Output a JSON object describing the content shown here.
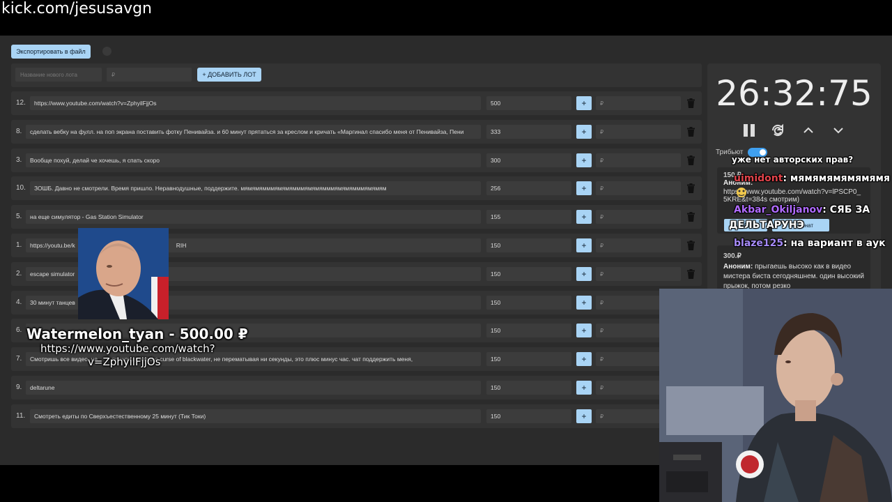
{
  "browser": {
    "url": "kick.com/jesusavgn"
  },
  "toolbar": {
    "export_label": "Экспортировать в файл"
  },
  "new_lot": {
    "name_placeholder": "Название нового лота",
    "amount_placeholder": "₽",
    "add_label": "+ ДОБАВИТЬ ЛОТ"
  },
  "lots": [
    {
      "num": "12.",
      "name": "https://www.youtube.com/watch?v=ZphyilFjjOs",
      "amount": "500"
    },
    {
      "num": "8.",
      "name": "сделать вебку на фулл. на поп экрана поставить фотку Пенивайза. и 60 минут прятаться за креслом и кричать «Маргинал спасибо меня от Пенивайза, Пени",
      "amount": "333"
    },
    {
      "num": "3.",
      "name": "Вообще похуй, делай че хочешь, я спать скоро",
      "amount": "300"
    },
    {
      "num": "10.",
      "name": "ЗОШБ. Давно не смотрели. Время пришло. Неравнодушные, поддержите. мямямямммямямямммямямямммямямямммямямям",
      "amount": "256"
    },
    {
      "num": "5.",
      "name": "на еще симулятор - Gas Station Simulator",
      "amount": "155"
    },
    {
      "num": "1.",
      "name": "https://youtu.be/k",
      "name_tail": "RIH",
      "amount": "150"
    },
    {
      "num": "2.",
      "name": "escape simulator",
      "amount": "150"
    },
    {
      "num": "4.",
      "name": "30 минут танцев",
      "amount": "150"
    },
    {
      "num": "6.",
      "name": "",
      "amount": "150"
    },
    {
      "num": "7.",
      "name": "Смотришь все видео, на            прохождение the curse of blackwater, не перематывая ни секунды, это плюс минус час. чат поддержить меня,",
      "amount": "150"
    },
    {
      "num": "9.",
      "name": "deltarune",
      "amount": "150"
    },
    {
      "num": "11.",
      "name": "Смотреть едиты по Сверхъестественному 25 минут (Тик Токи)",
      "amount": "150"
    }
  ],
  "lot_plus_label": "+",
  "lot_rub_placeholder": "₽",
  "timer": {
    "value": "26:32:75",
    "tribute_label": "Трибьют",
    "tribute_on": true
  },
  "donations": [
    {
      "amount": "150.₽",
      "author": "Аноним:",
      "text": "https://www.youtube.com/watch?v=lPSCP0_5KRE&t=384s смотрим)"
    },
    {
      "amount": "300.₽",
      "author": "Аноним:",
      "text": "прыгаешь высоко как в видео мистера биста сегодняшнем. один высокий прыжок, потом резко"
    }
  ],
  "donation_buttons": {
    "left": "С",
    "right": "ить донат"
  },
  "chat_overlay": [
    {
      "user": "uimidont",
      "message": ": мямямямямямямя"
    },
    {
      "user": "Akbar_Okiljanov",
      "message": ": СЯБ ЗА"
    },
    {
      "user": "",
      "message": "ДЕЛЬТАРУНЭ"
    },
    {
      "user": "blaze125",
      "message": ": на вариант в аук"
    }
  ],
  "chat_top_cut": "уже нет авторских прав?",
  "alert": {
    "title": "Watermelon_tyan - 500.00 ₽",
    "line1": "https://www.youtube.com/watch?",
    "line2": "v=ZphyilFjjOs"
  },
  "colors": {
    "accent": "#a9d4f5",
    "panel": "#333333",
    "background": "#2b2b2b"
  }
}
